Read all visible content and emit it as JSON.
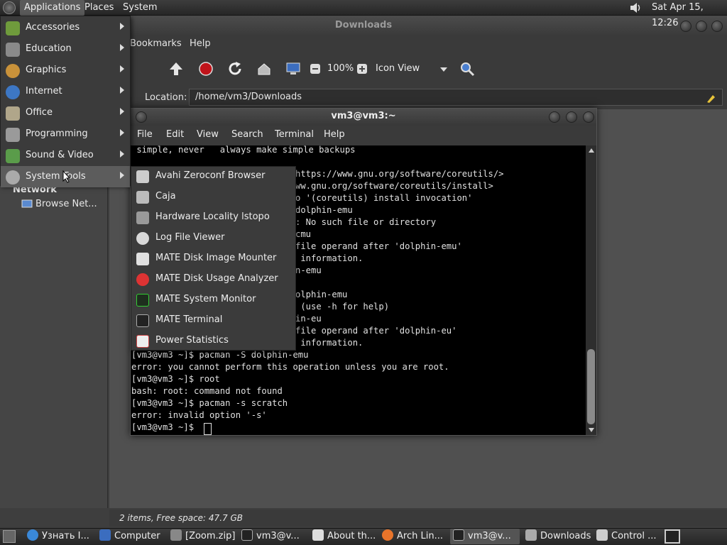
{
  "top_panel": {
    "menus": [
      "Applications",
      "Places",
      "System"
    ],
    "clock": "Sat Apr 15, 12:26"
  },
  "file_manager": {
    "title": "Downloads",
    "menu_partial": [
      "Bookmarks",
      "Help"
    ],
    "zoom": "100%",
    "view_mode": "Icon View",
    "location_label": "Location:",
    "location_value": "/home/vm3/Downloads",
    "sidebar": {
      "section": "Network",
      "item": "Browse Net..."
    },
    "status": "2 items, Free space: 47.7 GB"
  },
  "terminal": {
    "title": "vm3@vm3:~",
    "menus": [
      "File",
      "Edit",
      "View",
      "Search",
      "Terminal",
      "Help"
    ],
    "visible_fragments": [
      " simple, never   always make simple backups",
      "https://www.gnu.org/software/coreutils/>",
      "ww.gnu.org/software/coreutils/install>",
      "o '(coreutils) install invocation'",
      "dolphin-emu",
      ": No such file or directory",
      "cmu",
      "file operand after 'dolphin-emu'",
      " information.",
      "n-emu",
      "olphin-emu",
      " (use -h for help)",
      "in-eu",
      "file operand after 'dolphin-eu'",
      " information."
    ],
    "lines": [
      "[vm3@vm3 ~]$ pacman -S dolphin-emu",
      "error: you cannot perform this operation unless you are root.",
      "[vm3@vm3 ~]$ root",
      "bash: root: command not found",
      "[vm3@vm3 ~]$ pacman -s scratch",
      "error: invalid option '-s'",
      "[vm3@vm3 ~]$ "
    ]
  },
  "applications_menu": {
    "items": [
      "Accessories",
      "Education",
      "Graphics",
      "Internet",
      "Office",
      "Programming",
      "Sound & Video",
      "System Tools"
    ],
    "active": "System Tools"
  },
  "system_tools_menu": {
    "items": [
      "Avahi Zeroconf Browser",
      "Caja",
      "Hardware Locality lstopo",
      "Log File Viewer",
      "MATE Disk Image Mounter",
      "MATE Disk Usage Analyzer",
      "MATE System Monitor",
      "MATE Terminal",
      "Power Statistics"
    ]
  },
  "taskbar": {
    "tasks": [
      "Узнать I...",
      "Computer",
      "[Zoom.zip]",
      "vm3@v...",
      "About th...",
      "Arch Lin...",
      "vm3@v...",
      "Downloads",
      "Control ..."
    ],
    "active_task": "vm3@v..."
  }
}
